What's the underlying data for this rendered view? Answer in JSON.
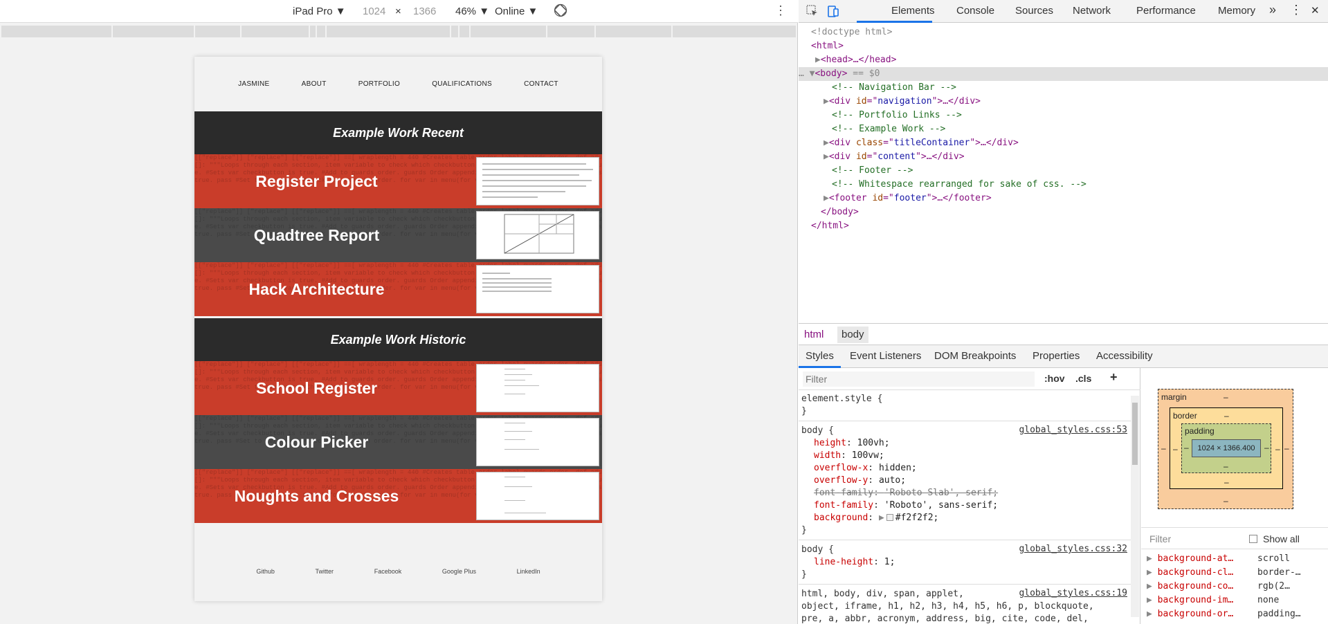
{
  "device_toolbar": {
    "device": "iPad Pro ▼",
    "width": "1024",
    "times": "×",
    "height": "1366",
    "zoom": "46% ▼",
    "network": "Online ▼",
    "menu": "⋮"
  },
  "site": {
    "nav": [
      "JASMINE",
      "ABOUT",
      "PORTFOLIO",
      "QUALIFICATIONS",
      "CONTACT"
    ],
    "section_recent": "Example Work Recent",
    "section_historic": "Example Work Historic",
    "recent_items": [
      "Register Project",
      "Quadtree Report",
      "Hack Architecture"
    ],
    "historic_items": [
      "School Register",
      "Colour Picker",
      "Noughts and Crosses"
    ],
    "bg_text": "[[\"replace\"]] [\"replace\"] [[\"replace\"]] ==[ wraplength = 440 #Creates table order label guards order. def add[]: \"\"\"Loops through each section, item variable to check which checkbutton is true. #Check for button is true. #Sets var checkbutton is true. #Add to guards order. guards Order appending # Check that whether button is true. pass #Set to next var. #Check for menu in order. for var in menu(for var in menu):",
    "footer": [
      "Github",
      "Twitter",
      "Facebook",
      "Google Plus",
      "LinkedIn"
    ],
    "colors": {
      "red": "#c93d2a",
      "grey": "#4a4a4a",
      "dark": "#2b2b2b"
    }
  },
  "devtools": {
    "tabs": [
      "Elements",
      "Console",
      "Sources",
      "Network",
      "Performance",
      "Memory"
    ],
    "more": "»",
    "menu": "⋮",
    "close": "✕",
    "dom": {
      "doctype": "<!doctype html>",
      "html_open": "<html>",
      "head": "<head>…</head>",
      "body_sel_marker": "== $0",
      "body_open": "<body>",
      "comment_nav": "<!-- Navigation Bar -->",
      "div_nav_id": "navigation",
      "comment_portfolio": "<!-- Portfolio Links -->",
      "comment_example": "<!-- Example Work -->",
      "div_title_class": "titleContainer",
      "div_content_id": "content",
      "comment_footer": "<!-- Footer -->",
      "comment_ws": "<!-- Whitespace rearranged for sake of css. -->",
      "footer_id": "footer",
      "body_close": "</body>",
      "html_close": "</html>"
    },
    "breadcrumb": [
      "html",
      "body"
    ],
    "subtabs": [
      "Styles",
      "Event Listeners",
      "DOM Breakpoints",
      "Properties",
      "Accessibility"
    ],
    "filter_placeholder": "Filter",
    "hov": ":hov",
    "cls": ".cls",
    "plus": "+",
    "rules": {
      "element_style": "element.style {",
      "close_brace": "}",
      "body1_sel": "body {",
      "body1_src": "global_styles.css:53",
      "body1_props": [
        {
          "p": "height",
          "v": "100vh;"
        },
        {
          "p": "width",
          "v": "100vw;"
        },
        {
          "p": "overflow-x",
          "v": "hidden;"
        },
        {
          "p": "overflow-y",
          "v": "auto;"
        },
        {
          "p": "font-family",
          "v": "'Roboto Slab', serif;"
        },
        {
          "p": "font-family",
          "v": "'Roboto', sans-serif;"
        },
        {
          "p": "background",
          "v": "#f2f2f2;"
        }
      ],
      "body2_sel": "body {",
      "body2_src": "global_styles.css:32",
      "body2_prop": {
        "p": "line-height",
        "v": "1;"
      },
      "reset_sel1": "html, body, div, span, applet,",
      "reset_sel2": "object, iframe, h1, h2, h3, h4, h5, h6, p, blockquote,",
      "reset_sel3": "pre, a, abbr, acronym, address, big, cite, code, del,",
      "reset_src": "global_styles.css:19"
    },
    "boxmodel": {
      "margin": "margin",
      "border": "border",
      "padding": "padding",
      "dash": "–",
      "content": "1024 × 1366.400"
    },
    "computed": {
      "filter": "Filter",
      "show_all": "Show all",
      "rows": [
        {
          "p": "background-at…",
          "v": "scroll"
        },
        {
          "p": "background-cl…",
          "v": "border-…"
        },
        {
          "p": "background-co…",
          "v": "rgb(2…"
        },
        {
          "p": "background-im…",
          "v": "none"
        },
        {
          "p": "background-or…",
          "v": "padding…"
        }
      ]
    }
  }
}
